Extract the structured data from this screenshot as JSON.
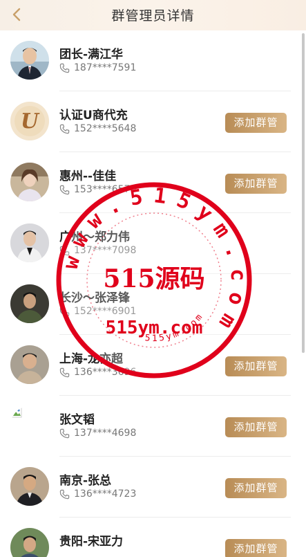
{
  "header": {
    "title": "群管理员详情",
    "back_icon": "chevron-left-icon"
  },
  "members": [
    {
      "name": "团长-满江华",
      "phone": "187****7591",
      "show_button": false
    },
    {
      "name": "认证U商代充",
      "phone": "152****5648",
      "show_button": true
    },
    {
      "name": "惠州--佳佳",
      "phone": "153****6570",
      "show_button": true
    },
    {
      "name": "广州～郑力伟",
      "phone": "137****7098",
      "show_button": false
    },
    {
      "name": "长沙～张泽锋",
      "phone": "152****6901",
      "show_button": false
    },
    {
      "name": "上海-龙亦超",
      "phone": "136****3696",
      "show_button": true
    },
    {
      "name": "张文韬",
      "phone": "137****4698",
      "show_button": true
    },
    {
      "name": "南京-张总",
      "phone": "136****4723",
      "show_button": true
    },
    {
      "name": "贵阳-宋亚力",
      "phone": "",
      "show_button": true
    }
  ],
  "add_button_label": "添加群管",
  "watermark": {
    "center_text": "515源码",
    "bottom_text": "515ym.com",
    "ring_text": "www.515ym.com",
    "small_text": "515ym.com",
    "color": "#e0001b"
  },
  "colors": {
    "accent_gold": "#c9a06a",
    "button_start": "#b88c56",
    "button_end": "#d9b585"
  }
}
